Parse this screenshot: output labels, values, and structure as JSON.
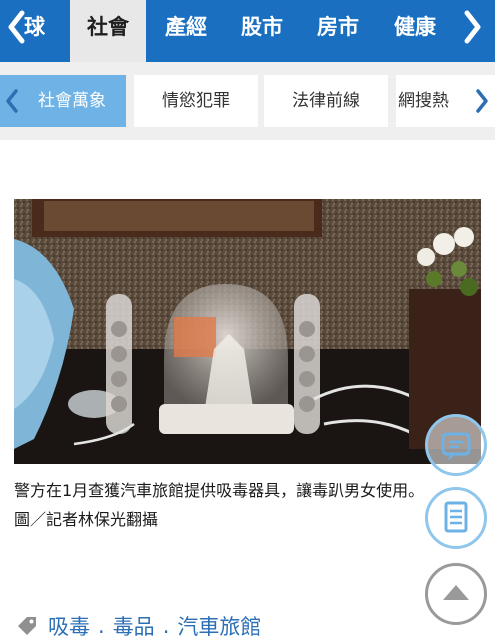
{
  "top_nav": {
    "partial_label": "球",
    "tabs": [
      {
        "label": "社會",
        "active": true
      },
      {
        "label": "產經"
      },
      {
        "label": "股市"
      },
      {
        "label": "房市"
      },
      {
        "label": "健康"
      }
    ],
    "left_arrow_icon": "chevron-left-icon",
    "right_arrow_icon": "chevron-right-icon"
  },
  "sub_nav": {
    "items": [
      {
        "label": "社會萬象",
        "active": true
      },
      {
        "label": "情慾犯罪"
      },
      {
        "label": "法律前線"
      },
      {
        "label": "網搜熱"
      }
    ]
  },
  "article": {
    "caption_line1": "警方在1月查獲汽車旅館提供吸毒器具，讓毒趴男女使用。",
    "caption_line2": "圖／記者林保光翻攝"
  },
  "tags": [
    "吸毒",
    "毒品",
    "汽車旅館"
  ],
  "tag_separator": ".",
  "colors": {
    "nav_bg": "#1a6fc0",
    "active_tab_bg": "#e8e8e8",
    "active_sub_bg": "#6fb3e6",
    "tag_text": "#2d6fb5"
  }
}
